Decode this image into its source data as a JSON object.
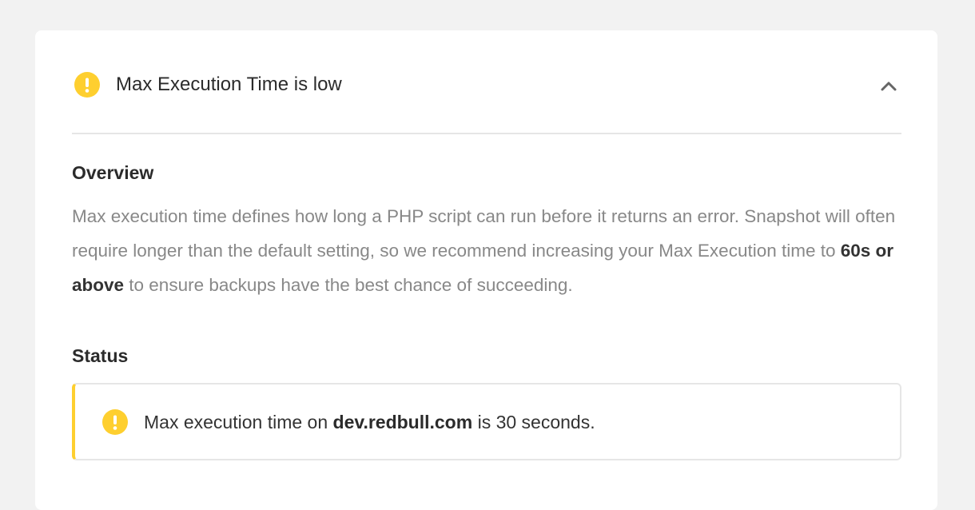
{
  "panel": {
    "title": "Max Execution Time is low",
    "title_icon": "warning-icon",
    "toggle_icon": "chevron-up-icon"
  },
  "overview": {
    "heading": "Overview",
    "text_before": "Max execution time defines how long a PHP script can run before it returns an error. Snapshot will often require longer than the default setting, so we recommend increasing your Max Execution time to ",
    "text_bold": "60s or above",
    "text_after": " to ensure backups have the best chance of succeeding."
  },
  "status": {
    "heading": "Status",
    "notice_icon": "warning-icon",
    "notice_before": "Max execution time on ",
    "notice_domain": "dev.redbull.com",
    "notice_after": " is 30 seconds."
  },
  "colors": {
    "warning": "#fecf2f",
    "background": "#f2f2f2",
    "card": "#ffffff",
    "muted_text": "#888888",
    "divider": "#e6e6e6"
  }
}
